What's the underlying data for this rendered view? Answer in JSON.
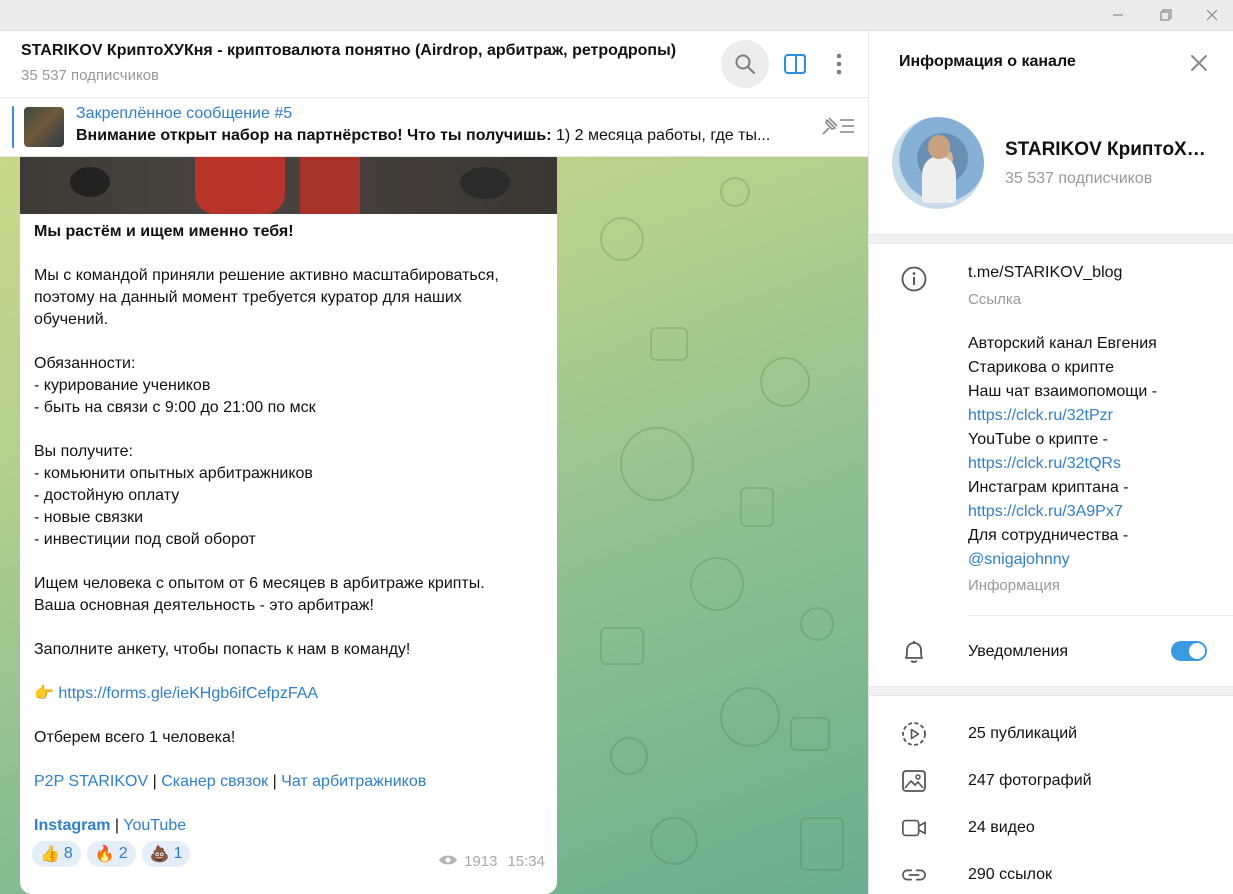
{
  "window": {
    "controls": [
      "minimize-icon",
      "restore-icon",
      "close-icon"
    ]
  },
  "header": {
    "title": "STARIKOV КриптоХУКня - криптовалюта понятно (Airdrop, арбитраж, ретродропы)",
    "subscribers": "35 537 подписчиков",
    "icons": [
      "search-icon",
      "sidebar-toggle-icon",
      "more-vertical-icon"
    ]
  },
  "pinned": {
    "title": "Закреплённое сообщение #5",
    "text_bold": "Внимание открыт набор на партнёрство!  Что ты получишь:",
    "text_rest": "  1) 2 месяца работы, где ты..."
  },
  "message": {
    "lines": [
      {
        "text": "Мы растём и ищем именно тебя!",
        "bold": true
      },
      {
        "text": ""
      },
      {
        "text": "Мы с командой приняли решение активно масштабироваться,"
      },
      {
        "text": "поэтому на данный момент требуется куратор для наших"
      },
      {
        "text": "обучений."
      },
      {
        "text": ""
      },
      {
        "text": "Обязанности:"
      },
      {
        "text": "- курирование учеников"
      },
      {
        "text": "- быть на связи с 9:00 до 21:00 по мск"
      },
      {
        "text": ""
      },
      {
        "text": "Вы получите:"
      },
      {
        "text": "- комьюнити опытных арбитражников"
      },
      {
        "text": "- достойную оплату"
      },
      {
        "text": "- новые связки"
      },
      {
        "text": "- инвестиции под свой оборот"
      },
      {
        "text": ""
      },
      {
        "text": "Ищем человека с опытом от 6 месяцев в арбитраже крипты."
      },
      {
        "text": "Ваша основная деятельность - это арбитраж!"
      },
      {
        "text": ""
      },
      {
        "text": "Заполните анкету, чтобы попасть к нам в команду!"
      }
    ],
    "form_emoji": "👉",
    "form_link": "https://forms.gle/ieKHgb6ifCefpzFAA",
    "select_text": "Отберем всего 1 человека!",
    "links_row1": [
      "P2P STARIKOV",
      "Сканер связок",
      "Чат арбитражников"
    ],
    "links_row2": [
      "Instagram",
      "YouTube"
    ],
    "separator": "|",
    "reactions": [
      {
        "emoji": "👍",
        "count": "8"
      },
      {
        "emoji": "🔥",
        "count": "2"
      },
      {
        "emoji": "💩",
        "count": "1"
      }
    ],
    "views": "1913",
    "time": "15:34"
  },
  "panel": {
    "title": "Информация о канале",
    "channel_name": "STARIKOV КриптоХУКня - криптовалюта понятно (Airdrop, арбитраж, ретродропы)",
    "subscribers": "35 537 подписчиков",
    "link": "t.me/STARIKOV_blog",
    "link_label": "Ссылка",
    "description": {
      "line1": "Авторский канал Евгения",
      "line2": "Старикова о крипте",
      "line3": "Наш чат взаимопомощи -",
      "link1": "https://clck.ru/32tPzr",
      "line4": "YouTube о крипте -",
      "link2": "https://clck.ru/32tQRs",
      "line5": "Инстаграм криптана -",
      "link3": "https://clck.ru/3A9Px7",
      "line6": "Для сотрудничества -",
      "handle": "@snigajohnny"
    },
    "description_label": "Информация",
    "notifications_label": "Уведомления",
    "notifications_on": true,
    "media": [
      {
        "icon": "play-circle-icon",
        "label": "25 публикаций"
      },
      {
        "icon": "image-icon",
        "label": "247 фотографий"
      },
      {
        "icon": "video-icon",
        "label": "24 видео"
      },
      {
        "icon": "link-icon",
        "label": "290 ссылок"
      }
    ]
  },
  "colors": {
    "accent": "#2f7fc8",
    "toggle": "#3a9ae0",
    "muted": "#999999"
  }
}
